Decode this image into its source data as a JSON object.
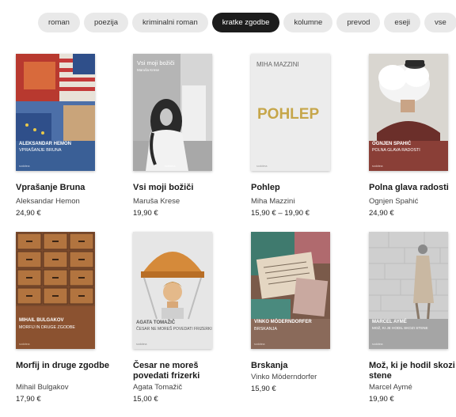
{
  "filters": [
    {
      "label": "roman",
      "active": false
    },
    {
      "label": "poezija",
      "active": false
    },
    {
      "label": "kriminalni roman",
      "active": false
    },
    {
      "label": "kratke zgodbe",
      "active": true
    },
    {
      "label": "kolumne",
      "active": false
    },
    {
      "label": "prevod",
      "active": false
    },
    {
      "label": "eseji",
      "active": false
    },
    {
      "label": "vse",
      "active": false
    }
  ],
  "books": [
    {
      "title": "Vprašanje Bruna",
      "author": "Aleksandar Hemon",
      "price": "24,90 €",
      "cover": {
        "author": "ALEKSANDAR HEMON",
        "title": "VPRAŠANJE BRUNA",
        "publisher": "sodobna"
      }
    },
    {
      "title": "Vsi moji božiči",
      "author": "Maruša Krese",
      "price": "19,90 €",
      "cover": {
        "title": "Vsi moji božiči",
        "author": "Maruša Krese",
        "publisher": "sodobna"
      }
    },
    {
      "title": "Pohlep",
      "author": "Miha Mazzini",
      "price": "15,90 € – 19,90 €",
      "cover": {
        "author": "MIHA MAZZINI",
        "title": "POHLEP",
        "publisher": "sodobna"
      }
    },
    {
      "title": "Polna glava radosti",
      "author": "Ognjen Spahić",
      "price": "24,90 €",
      "cover": {
        "author": "OGNJEN SPAHIĆ",
        "title": "POLNA GLAVA RADOSTI",
        "publisher": "sodobna"
      }
    },
    {
      "title": "Morfij in druge zgodbe",
      "author": "Mihail Bulgakov",
      "price": "17,90 €",
      "cover": {
        "author": "MIHAIL BULGAKOV",
        "title": "MORFIJ IN DRUGE ZGODBE",
        "publisher": "sodobna"
      }
    },
    {
      "title": "Česar ne moreš povedati frizerki",
      "author": "Agata Tomažič",
      "price": "15,00 €",
      "cover": {
        "author": "AGATA TOMAŽIČ",
        "title": "ČESAR NE MOREŠ POVEDATI FRIZERKI",
        "publisher": "sodobna"
      }
    },
    {
      "title": "Brskanja",
      "author": "Vinko Möderndorfer",
      "price": "15,90 €",
      "cover": {
        "author": "VINKO MÖDERNDORFER",
        "title": "BRSKANJA",
        "publisher": "sodobna"
      }
    },
    {
      "title": "Mož, ki je hodil skozi stene",
      "author": "Marcel Aymé",
      "price": "19,90 €",
      "cover": {
        "author": "MARCEL AYMÉ",
        "title": "MOŽ, KI JE HODIL SKOZI STENE",
        "publisher": "sodobna"
      }
    }
  ]
}
